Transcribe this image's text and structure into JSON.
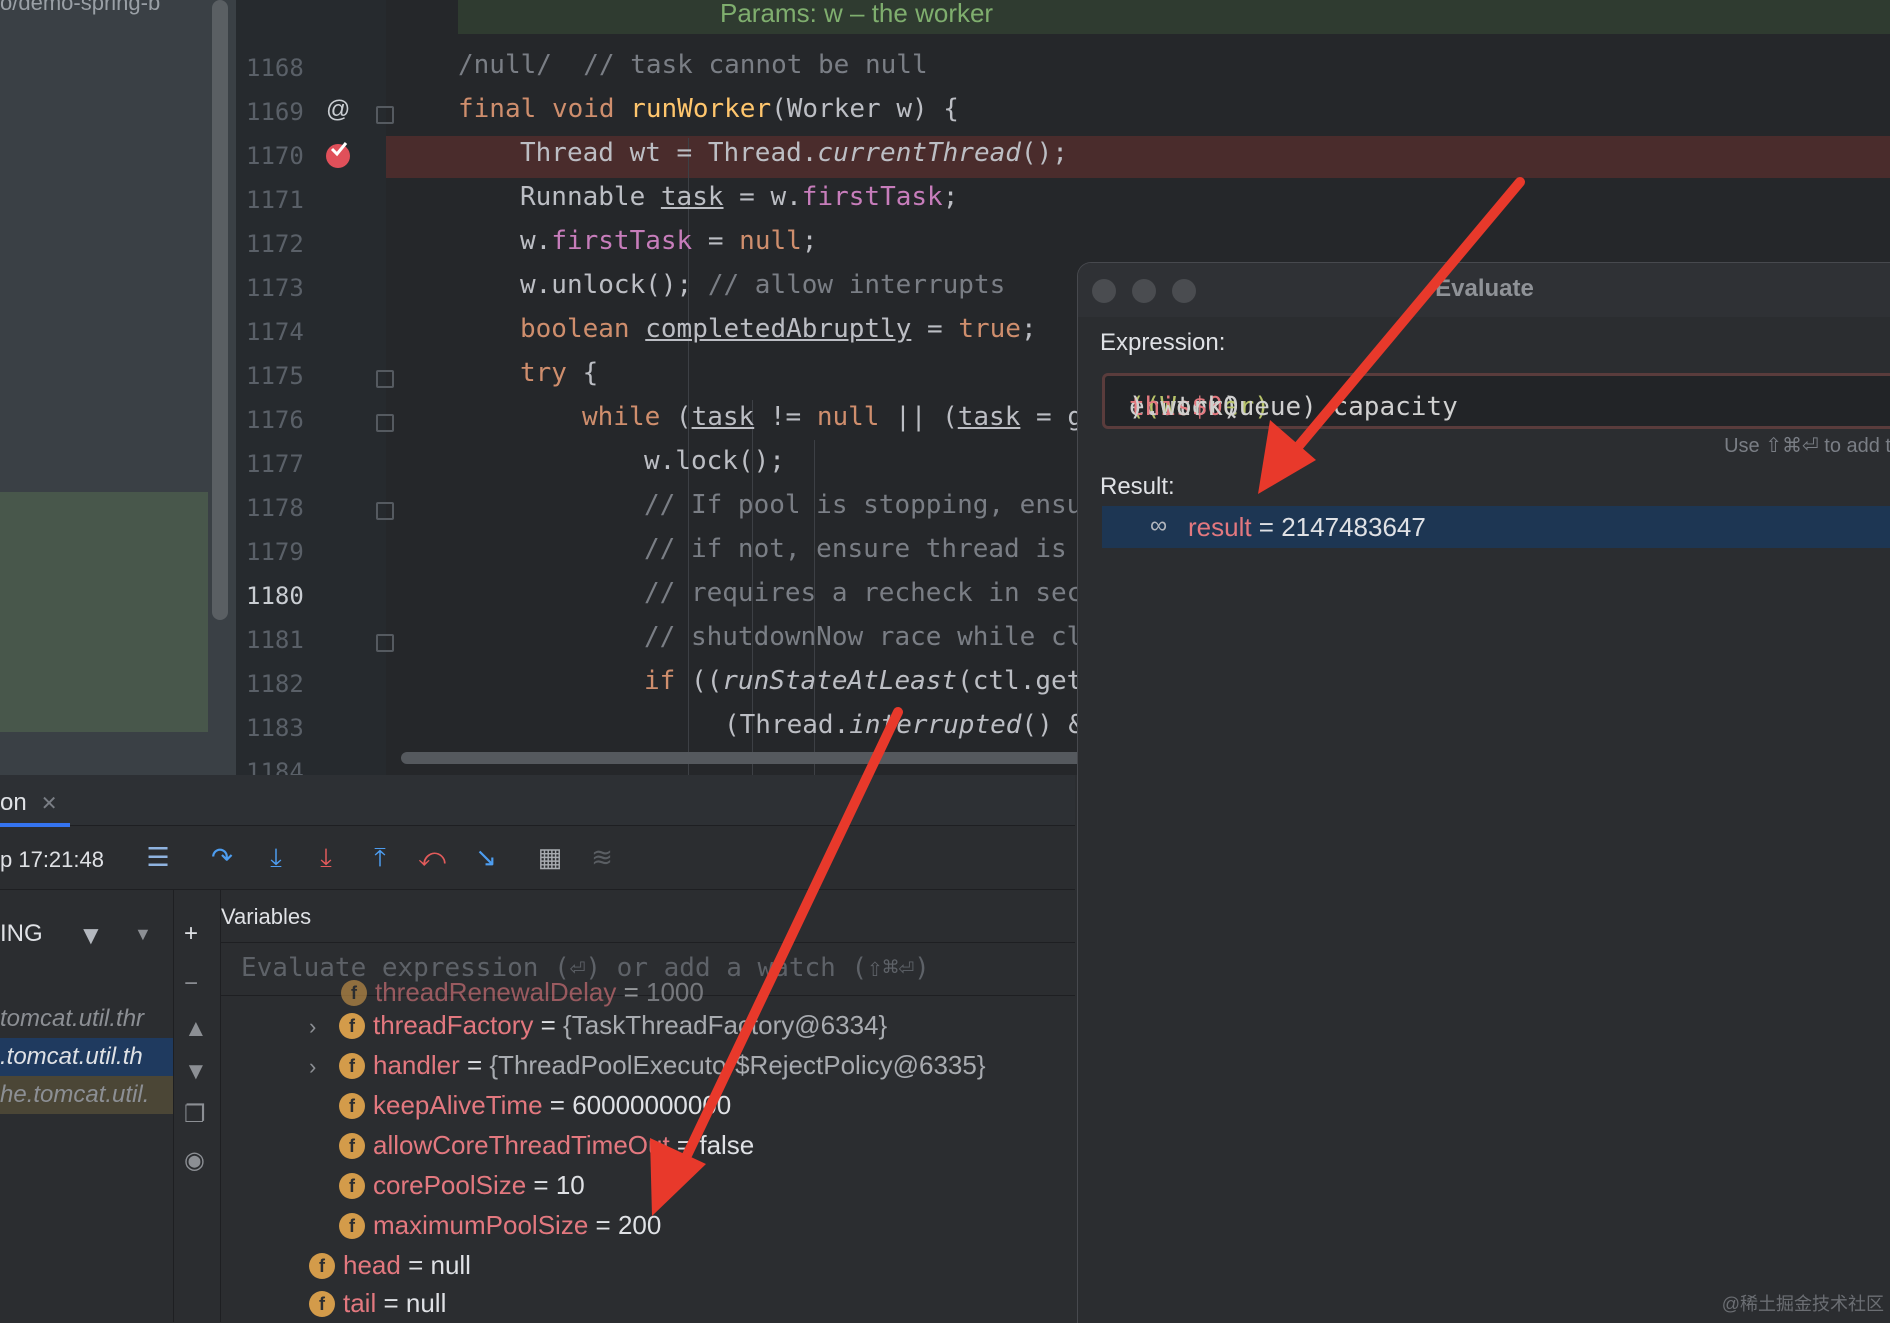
{
  "colors": {
    "arrow": "#e8392b",
    "selection": "#1d3653",
    "breakpoint": "#e0505a"
  },
  "project": {
    "breadcrumb": "o/demo-spring-b"
  },
  "editor": {
    "doc_hint": "Params: w – the worker",
    "line_numbers": [
      "1168",
      "1169",
      "1170",
      "1171",
      "1172",
      "1173",
      "1174",
      "1175",
      "1176",
      "1177",
      "1178",
      "1179",
      "1180",
      "1181",
      "1182",
      "1183",
      "1184"
    ],
    "gutter_icons": {
      "override": "@",
      "breakpoint": "breakpoint-check-icon"
    },
    "lines": {
      "l1168": {
        "c1": "/null/",
        "c2": "  // task cannot be null"
      },
      "l1169": {
        "k1": "final",
        "k2": "void",
        "fn": "runWorker",
        "rest": "(Worker w) {"
      },
      "l1170": {
        "a": "Thread wt = Thread.",
        "m": "currentThread",
        "b": "();"
      },
      "l1171": {
        "a": "Runnable ",
        "v": "task",
        "b": " = w.",
        "f": "firstTask",
        "c": ";"
      },
      "l1172": {
        "a": "w.",
        "f": "firstTask",
        "b": " = ",
        "k": "null",
        "c": ";"
      },
      "l1173": {
        "a": "w.unlock();",
        "cm": " // allow interrupts"
      },
      "l1174": {
        "k": "boolean ",
        "v": "completedAbruptly",
        "b": " = ",
        "k2": "true",
        "c": ";"
      },
      "l1175": {
        "k": "try",
        "b": " {"
      },
      "l1176": {
        "k": "while",
        "a": " (",
        "v": "task",
        "b": " != ",
        "k2": "null",
        "c": " || (",
        "v2": "task",
        "d": " = g"
      },
      "l1177": {
        "a": "w.lock();"
      },
      "l1178": {
        "cm": "// If pool is stopping, ensu"
      },
      "l1179": {
        "cm": "// if not, ensure thread is"
      },
      "l1180": {
        "cm": "// requires a recheck in sec"
      },
      "l1181": {
        "cm": "// shutdownNow race while cl"
      },
      "l1182": {
        "k": "if",
        "a": " ((",
        "m": "runStateAtLeast",
        "b": "(ctl.get"
      },
      "l1183": {
        "a": "(Thread.",
        "m": "interrupted",
        "b": "() &"
      }
    }
  },
  "debug": {
    "tab_label": "on",
    "timestamp": "p 17:21:48",
    "thread_filter": "ING",
    "frames": [
      "tomcat.util.thr",
      ".tomcat.util.th",
      "he.tomcat.util."
    ],
    "variables_title": "Variables",
    "eval_placeholder": "Evaluate expression (⏎) or add a watch (⇧⌘⏎)",
    "vars": [
      {
        "name": "threadRenewalDelay",
        "value": "1000",
        "partial": true
      },
      {
        "name": "threadFactory",
        "value": "{TaskThreadFactory@6334}",
        "expandable": true
      },
      {
        "name": "handler",
        "value": "{ThreadPoolExecutor$RejectPolicy@6335}",
        "expandable": true
      },
      {
        "name": "keepAliveTime",
        "value": "60000000000"
      },
      {
        "name": "allowCoreThreadTimeOut",
        "value": "false"
      },
      {
        "name": "corePoolSize",
        "value": "10"
      },
      {
        "name": "maximumPoolSize",
        "value": "200"
      },
      {
        "name": "head",
        "value": "null"
      },
      {
        "name": "tail",
        "value": "null"
      }
    ]
  },
  "evaluate": {
    "title": "Evaluate",
    "expression_label": "Expression:",
    "expression": {
      "p1": "ecutor)",
      "p2": "((Worker)",
      "p3": "this",
      "p4": ").",
      "p5": "this$0",
      "p6": ").workQueue).capacity"
    },
    "hint": "Use ⇧⌘⏎ to add t",
    "result_label": "Result:",
    "result": {
      "name": "result",
      "eq": " = ",
      "value": "2147483647"
    }
  },
  "watermark": "@稀土掘金技术社区"
}
